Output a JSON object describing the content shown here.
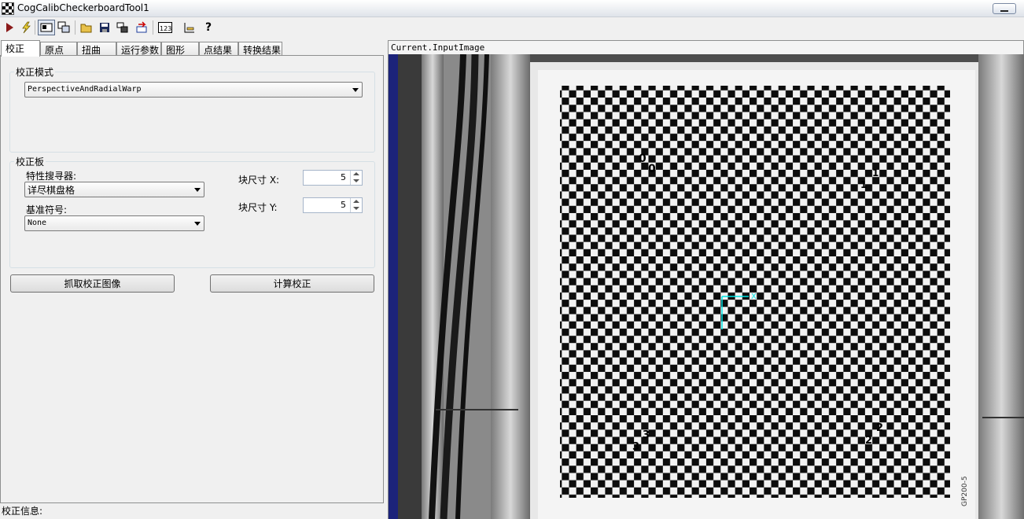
{
  "window": {
    "title": "CogCalibCheckerboardTool1"
  },
  "toolbar": {
    "buttons": [
      "run-icon",
      "electric-icon",
      "display-icon",
      "window-icon",
      "open-icon",
      "save-icon",
      "settings-icon",
      "reset-icon",
      "number-icon",
      "tool-icon",
      "help-icon"
    ]
  },
  "tabs": [
    "校正",
    "原点",
    "扭曲",
    "运行参数",
    "图形",
    "点结果",
    "转换结果"
  ],
  "calib_mode": {
    "title": "校正模式",
    "value": "PerspectiveAndRadialWarp"
  },
  "calib_plate": {
    "title": "校正板",
    "feature_finder_label": "特性搜寻器:",
    "feature_finder_value": "详尽棋盘格",
    "fiducial_label": "基准符号:",
    "fiducial_value": "None",
    "tile_x_label": "块尺寸 X:",
    "tile_x_value": "5",
    "tile_y_label": "块尺寸 Y:",
    "tile_y_value": "5"
  },
  "actions": {
    "grab_label": "抓取校正图像",
    "compute_label": "计算校正"
  },
  "status": {
    "label": "校正信息:"
  },
  "image": {
    "title": "Current.InputImage",
    "board_marks": [
      "0",
      "0",
      "1",
      "1",
      "3",
      "3",
      "2",
      "2"
    ],
    "origin_axis_label": "X",
    "board_code": "GP200-5",
    "accent_color": "#00e5e5"
  }
}
